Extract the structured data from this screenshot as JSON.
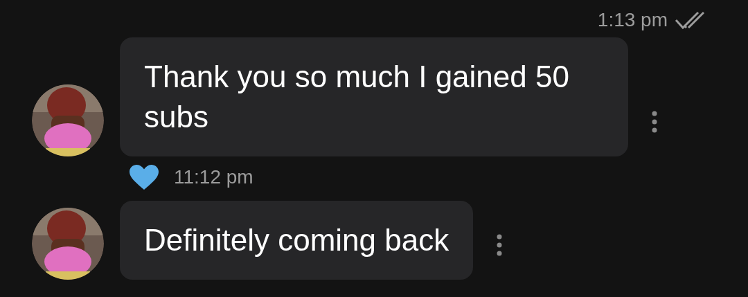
{
  "header": {
    "time": "1:13 pm",
    "read": true
  },
  "messages": [
    {
      "text": "Thank you so much I gained 50 subs",
      "liked": true,
      "time": "11:12 pm"
    },
    {
      "text": "Definitely coming back"
    }
  ]
}
